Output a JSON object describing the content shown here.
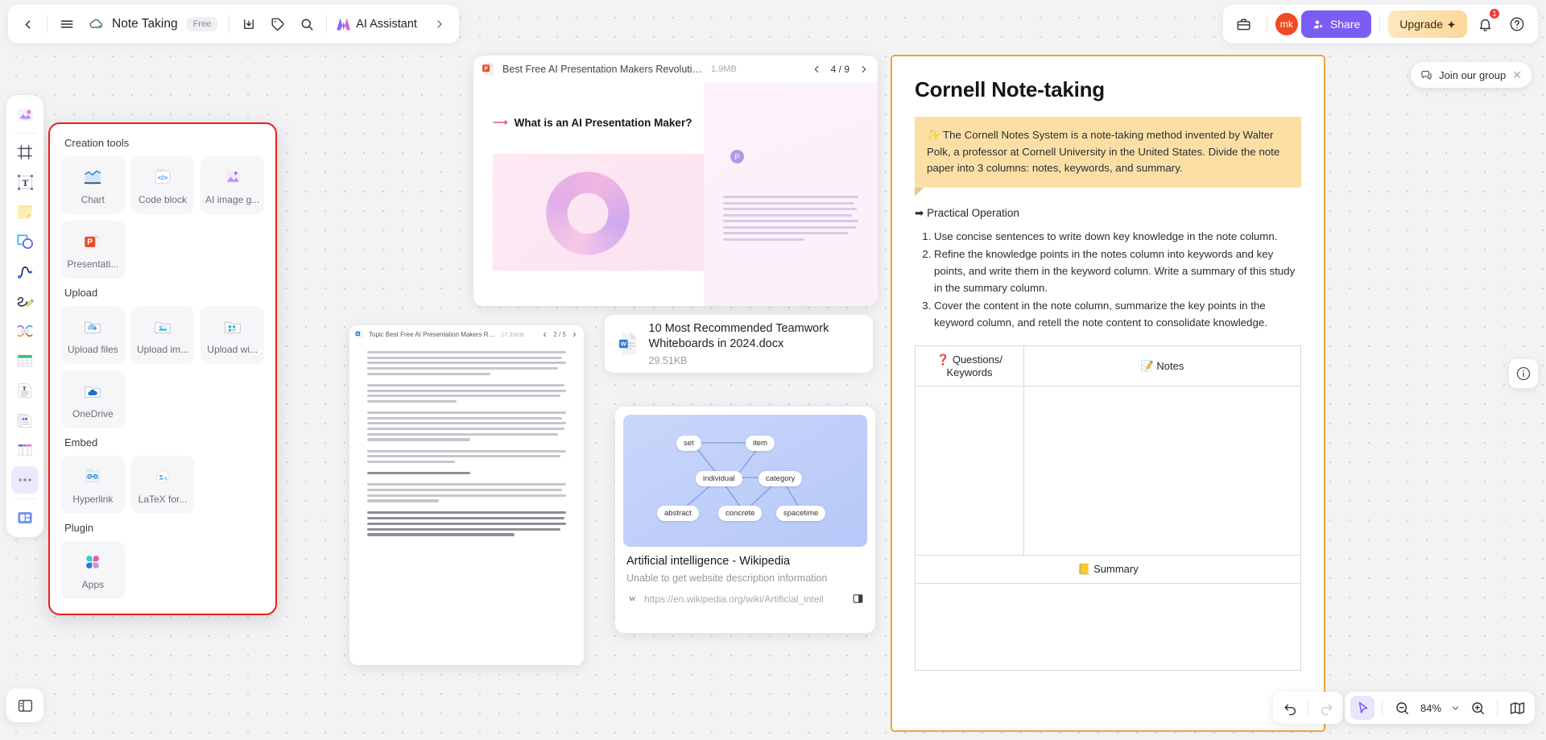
{
  "topbar": {
    "back_icon": "chevron-left-icon",
    "menu_icon": "hamburger-menu-icon",
    "cloud_icon": "cloud-sync-icon",
    "doc_title": "Note Taking",
    "plan_badge": "Free",
    "download_icon": "download-icon",
    "tag_icon": "tag-icon",
    "search_icon": "search-icon",
    "ai_assistant_label": "AI Assistant",
    "expand_icon": "chevron-right-icon"
  },
  "topbar_right": {
    "toolbox_icon": "briefcase-icon",
    "avatar_initials": "mk",
    "share_label": "Share",
    "share_icon": "user-add-icon",
    "share_color": "#7b5cf5",
    "upgrade_label": "Upgrade",
    "upgrade_icon": "diamond-icon",
    "notification_icon": "bell-icon",
    "notification_count": "1",
    "notification_color": "#f03b3b",
    "help_icon": "question-circle-icon"
  },
  "join_group": {
    "label": "Join our group",
    "icon": "chat-group-icon",
    "close_icon": "close-icon"
  },
  "left_toolbar": {
    "items": [
      {
        "name": "sticker-tool",
        "icon": "sticker-gallery-icon"
      },
      {
        "name": "frame-tool",
        "icon": "frame-crop-icon"
      },
      {
        "name": "text-tool",
        "icon": "text-box-icon"
      },
      {
        "name": "sticky-note-tool",
        "icon": "sticky-note-icon"
      },
      {
        "name": "shape-tool",
        "icon": "shapes-icon"
      },
      {
        "name": "connector-tool",
        "icon": "curve-line-icon"
      },
      {
        "name": "pen-tool",
        "icon": "pencil-scribble-icon"
      },
      {
        "name": "mindmap-tool",
        "icon": "mind-map-icon"
      },
      {
        "name": "table-tool",
        "icon": "table-grid-icon"
      },
      {
        "name": "document-tool",
        "icon": "text-document-icon"
      },
      {
        "name": "slide-tool",
        "icon": "slides-document-icon"
      },
      {
        "name": "kanban-tool",
        "icon": "kanban-board-icon"
      },
      {
        "name": "more-tools",
        "icon": "more-dots-icon"
      }
    ],
    "bottom_item": {
      "name": "templates",
      "icon": "template-library-icon"
    }
  },
  "creation_panel": {
    "sections": [
      {
        "title": "Creation tools",
        "items": [
          {
            "label": "Chart",
            "icon": "chart-icon"
          },
          {
            "label": "Code block",
            "icon": "code-block-icon"
          },
          {
            "label": "AI image g...",
            "icon": "ai-image-icon"
          },
          {
            "label": "Presentati...",
            "icon": "powerpoint-icon"
          }
        ]
      },
      {
        "title": "Upload",
        "items": [
          {
            "label": "Upload files",
            "icon": "upload-folder-icon"
          },
          {
            "label": "Upload im...",
            "icon": "upload-image-icon"
          },
          {
            "label": "Upload wi...",
            "icon": "upload-widget-icon"
          },
          {
            "label": "OneDrive",
            "icon": "onedrive-icon"
          }
        ]
      },
      {
        "title": "Embed",
        "items": [
          {
            "label": "Hyperlink",
            "icon": "hyperlink-icon"
          },
          {
            "label": "LaTeX for...",
            "icon": "latex-formula-icon"
          }
        ]
      },
      {
        "title": "Plugin",
        "items": [
          {
            "label": "Apps",
            "icon": "apps-grid-icon"
          }
        ]
      }
    ],
    "highlight_color": "#f01c1c"
  },
  "ppt_card": {
    "file_icon": "powerpoint-file-icon",
    "file_name": "Best Free AI Presentation Makers Revolutionize Your ....ppt",
    "file_size": "1.9MB",
    "prev_icon": "chevron-left-icon",
    "page_indicator": "4 / 9",
    "next_icon": "chevron-right-icon",
    "slide_title": "What is an AI Presentation Maker?",
    "slide_marker": "P",
    "slide_body": "AI presentation makers are automated tools leveraging AI technologies to streamline the creation of digital presentations. These platforms go beyond the capabilities of conventional presentation software by incorporating intelligent features like automated design suggestions, content optimization, data analysis, and more."
  },
  "doc_preview": {
    "file_icon": "word-file-icon",
    "file_name": "Topic Best Free AI Presentation Makers Revolutionize Your ...",
    "file_size": "17.35KB",
    "prev_icon": "chevron-left-icon",
    "page_indicator": "2 / 5",
    "next_icon": "chevron-right-icon"
  },
  "docx_card": {
    "file_icon": "word-file-icon",
    "title": "10 Most Recommended Teamwork Whiteboards in 2024.docx",
    "size": "29.51KB"
  },
  "wiki_card": {
    "nodes": [
      "set",
      "item",
      "individual",
      "category",
      "abstract",
      "concrete",
      "spacetime"
    ],
    "title": "Artificial intelligence - Wikipedia",
    "description": "Unable to get website description information",
    "favicon": "wikipedia-icon",
    "url": "https://en.wikipedia.org/wiki/Artificial_intell",
    "action_icon": "open-panel-icon"
  },
  "cornell": {
    "heading": "Cornell Note-taking",
    "callout_emoji": "✨",
    "callout_text": "The Cornell Notes System is a note-taking method invented by Walter Polk, a professor at Cornell University in the United States. Divide the note paper into 3 columns: notes, keywords, and summary.",
    "callout_color": "#fcdfa5",
    "practical_arrow": "➡",
    "practical_title": "Practical Operation",
    "steps": [
      "Use concise sentences to write down key knowledge in the note column.",
      "Refine the knowledge points in the notes column into keywords and key points, and write them in the keyword column. Write a summary of this study in the summary column.",
      "Cover the content in the note column, summarize the key points in the keyword column, and retell the note content to consolidate knowledge."
    ],
    "table": {
      "col1_emoji": "❓",
      "col1_header": "Questions/ Keywords",
      "col2_emoji": "📝",
      "col2_header": "Notes",
      "summary_emoji": "📒",
      "summary_header": "Summary"
    },
    "border_color": "#f0a33c"
  },
  "info_float": {
    "icon": "info-circle-icon"
  },
  "bottom_bar": {
    "undo_icon": "undo-arrow-icon",
    "redo_icon": "redo-arrow-icon",
    "cursor_icon": "cursor-pointer-icon",
    "zoom_out_icon": "zoom-out-icon",
    "zoom_level": "84%",
    "chevron_icon": "chevron-down-icon",
    "zoom_in_icon": "zoom-in-icon",
    "fit_icon": "map-fit-icon",
    "accent_color": "#7b5cf5"
  }
}
